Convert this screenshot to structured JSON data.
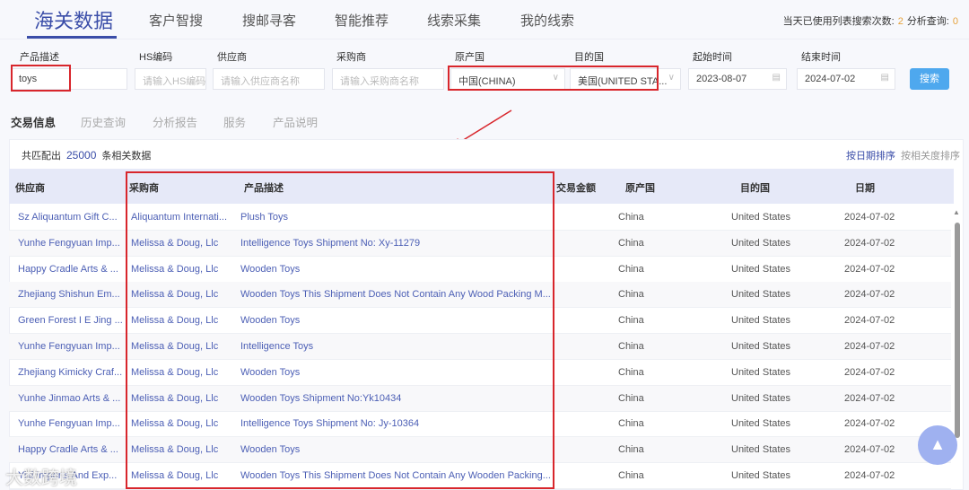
{
  "nav": {
    "tabs": [
      "海关数据",
      "客户智搜",
      "搜邮寻客",
      "智能推荐",
      "线索采集",
      "我的线索"
    ],
    "quota_label": "当天已使用列表搜索次数:",
    "quota_value": "2",
    "analysis_label": "分析查询:",
    "analysis_value": "0"
  },
  "filters": {
    "product_label": "产品描述",
    "product_value": "toys",
    "hs_label": "HS编码",
    "hs_placeholder": "请输入HS编码",
    "supplier_label": "供应商",
    "supplier_placeholder": "请输入供应商名称",
    "buyer_label": "采购商",
    "buyer_placeholder": "请输入采购商名称",
    "origin_label": "原产国",
    "origin_value": "中国(CHINA)",
    "dest_label": "目的国",
    "dest_value": "美国(UNITED STA...",
    "start_label": "起始时间",
    "start_value": "2023-08-07",
    "end_label": "结束时间",
    "end_value": "2024-07-02",
    "search_label": "搜索"
  },
  "subtabs": [
    "交易信息",
    "历史查询",
    "分析报告",
    "服务",
    "产品说明"
  ],
  "results": {
    "prefix": "共匹配出",
    "count": "25000",
    "suffix": "条相关数据",
    "sort_date": "按日期排序",
    "sort_relevance": "按相关度排序"
  },
  "columns": [
    "供应商",
    "采购商",
    "产品描述",
    "交易金额",
    "原产国",
    "目的国",
    "日期"
  ],
  "rows": [
    [
      "Sz Aliquantum Gift C...",
      "Aliquantum Internati...",
      "Plush Toys",
      "",
      "China",
      "United States",
      "2024-07-02"
    ],
    [
      "Yunhe Fengyuan Imp...",
      "Melissa & Doug, Llc",
      "Intelligence Toys Shipment No: Xy-11279",
      "",
      "China",
      "United States",
      "2024-07-02"
    ],
    [
      "Happy Cradle Arts & ...",
      "Melissa & Doug, Llc",
      "Wooden Toys",
      "",
      "China",
      "United States",
      "2024-07-02"
    ],
    [
      "Zhejiang Shishun Em...",
      "Melissa & Doug, Llc",
      "Wooden Toys This Shipment Does Not Contain Any Wood Packing M...",
      "",
      "China",
      "United States",
      "2024-07-02"
    ],
    [
      "Green Forest I E Jing ...",
      "Melissa & Doug, Llc",
      "Wooden Toys",
      "",
      "China",
      "United States",
      "2024-07-02"
    ],
    [
      "Yunhe Fengyuan Imp...",
      "Melissa & Doug, Llc",
      "Intelligence Toys",
      "",
      "China",
      "United States",
      "2024-07-02"
    ],
    [
      "Zhejiang Kimicky Craf...",
      "Melissa & Doug, Llc",
      "Wooden Toys",
      "",
      "China",
      "United States",
      "2024-07-02"
    ],
    [
      "Yunhe Jinmao Arts & ...",
      "Melissa & Doug, Llc",
      "Wooden Toys Shipment No:Yk10434",
      "",
      "China",
      "United States",
      "2024-07-02"
    ],
    [
      "Yunhe Fengyuan Imp...",
      "Melissa & Doug, Llc",
      "Intelligence Toys Shipment No: Jy-10364",
      "",
      "China",
      "United States",
      "2024-07-02"
    ],
    [
      "Happy Cradle Arts & ...",
      "Melissa & Doug, Llc",
      "Wooden Toys",
      "",
      "China",
      "United States",
      "2024-07-02"
    ],
    [
      "Yixi Imports And Exp...",
      "Melissa & Doug, Llc",
      "Wooden Toys This Shipment Does Not Contain Any Wooden Packing...",
      "",
      "China",
      "United States",
      "2024-07-02"
    ]
  ],
  "watermark": "大数跨境",
  "colors": {
    "accent": "#3a4da8",
    "highlight": "#d8262c",
    "button": "#4ea8ee"
  }
}
